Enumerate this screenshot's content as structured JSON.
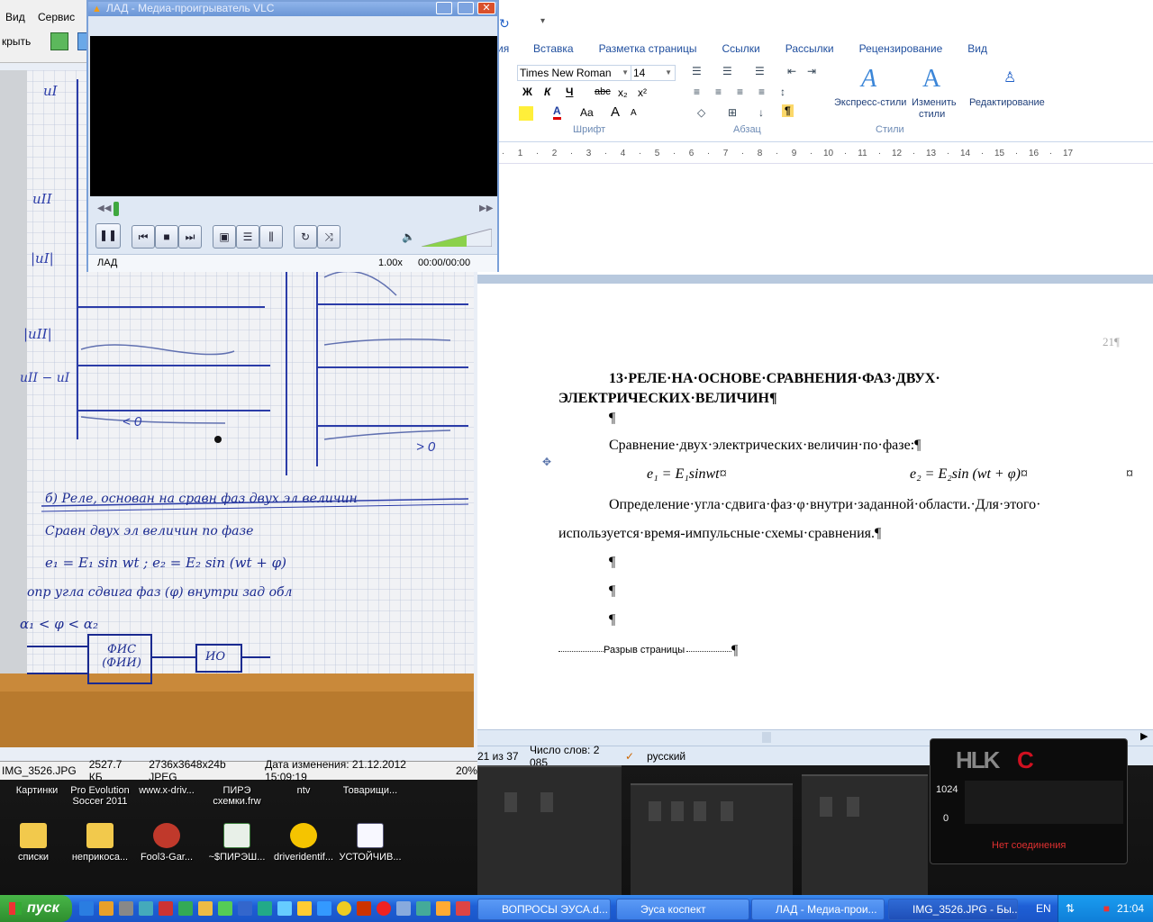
{
  "word": {
    "menu": {
      "insert": "Вставка",
      "layout": "Разметка страницы",
      "refs": "Ссылки",
      "mailings": "Рассылки",
      "review": "Рецензирование",
      "view": "Вид",
      "partial": "ия"
    },
    "font_name": "Times New Roman",
    "font_size": "14",
    "groups": {
      "font": "Шрифт",
      "paragraph": "Абзац",
      "styles": "Стили"
    },
    "styles_btns": {
      "express": "Экспресс-стили",
      "change1": "Изменить",
      "change2": "стили",
      "editing": "Редактирование"
    },
    "fmt": {
      "bold": "Ж",
      "italic": "К",
      "underline": "Ч",
      "strike": "abc",
      "sub": "x₂",
      "sup": "x²",
      "case": "Aa",
      "grow": "A",
      "shrink": "A",
      "pilcrow": "¶"
    },
    "ruler": [
      "1",
      "·",
      "1",
      "·",
      "2",
      "·",
      "3",
      "·",
      "4",
      "·",
      "5",
      "·",
      "6",
      "·",
      "7",
      "·",
      "8",
      "·",
      "9",
      "·",
      "10",
      "·",
      "11",
      "·",
      "12",
      "·",
      "13",
      "·",
      "14",
      "·",
      "15",
      "·",
      "16",
      "·",
      "17"
    ],
    "page_num": "21¶",
    "heading1": "13·РЕЛЕ·НА·ОСНОВЕ·СРАВНЕНИЯ·ФАЗ·ДВУХ·",
    "heading2": "ЭЛЕКТРИЧЕСКИХ·ВЕЛИЧИН¶",
    "pil": "¶",
    "p1": "Сравнение·двух·электрических·величин·по·фазе:¶",
    "eq1": "e₁ = E₁sinwt¤",
    "eq2": "e₂ = E₂sin (wt + φ)¤",
    "cell_mark": "¤",
    "p2a": "Определение·угла·сдвига·фаз·φ·внутри·заданной·области.·Для·этого·",
    "p2b": "используется·время-импульсные·схемы·сравнения.¶",
    "page_break": "Разрыв страницы",
    "status": {
      "page": "21 из 37",
      "words": "Число слов: 2 085",
      "lang": "русский"
    }
  },
  "vlc": {
    "title": "ЛАД - Медиа-проигрыватель VLC",
    "track": "ЛАД",
    "speed": "1.00x",
    "time": "00:00/00:00",
    "controls": {
      "pause": "❚❚",
      "prev": "⏮",
      "stop": "■",
      "next": "⏭",
      "rewind": "◀◀",
      "ffwd": "▶▶"
    }
  },
  "viewer": {
    "menu": {
      "view": "Вид",
      "service": "Сервис",
      "open": "крыть"
    },
    "status": {
      "file": "IMG_3526.JPG",
      "size": "2527.7 КБ",
      "dims": "2736x3648x24b JPEG",
      "modified": "Дата изменения: 21.12.2012 15:09:19",
      "zoom": "20%"
    },
    "notes": {
      "l1": "б) Реле, основан на сравн фаз двух эл величин",
      "l2": "Сравн двух эл величин по фазе",
      "l3": "e₁ = E₁ sin wt ;     e₂ = E₂ sin (wt + φ)",
      "l4": "опр угла сдвига фаз (φ) внутри зад обл",
      "l5": "α₁ < φ < α₂",
      "box1": "ФИС (ФИИ)",
      "box2": "ИО",
      "lt0": "< 0",
      "gt0": "> 0"
    }
  },
  "desktop_icons": [
    {
      "label": "Картинки"
    },
    {
      "label": "Pro Evolution Soccer 2011"
    },
    {
      "label": "www.x-driv..."
    },
    {
      "label": "ПИРЭ схемки.frw"
    },
    {
      "label": "ntv"
    },
    {
      "label": "Товарищи..."
    },
    {
      "label": "списки"
    },
    {
      "label": "неприкоса..."
    },
    {
      "label": "Fool3-Gar..."
    },
    {
      "label": "~$ПИРЭШ..."
    },
    {
      "label": "driveridentif..."
    },
    {
      "label": "УСТОЙЧИВ..."
    }
  ],
  "net": {
    "val1": "1024",
    "val2": "0",
    "status": "Нет соединения"
  },
  "taskbar": {
    "start": "пуск",
    "tasks": [
      {
        "label": "ВОПРОСЫ ЭУСА.d..."
      },
      {
        "label": "Эуса коспект"
      },
      {
        "label": "ЛАД - Медиа-прои..."
      },
      {
        "label": "IMG_3526.JPG - Бы..."
      }
    ],
    "lang": "EN",
    "clock": "21:04"
  },
  "colors": {
    "accent": "#1f4e9e",
    "taskbar": "#1e5fd6",
    "start": "#2e8e2e",
    "ink": "#2b3ca8"
  }
}
